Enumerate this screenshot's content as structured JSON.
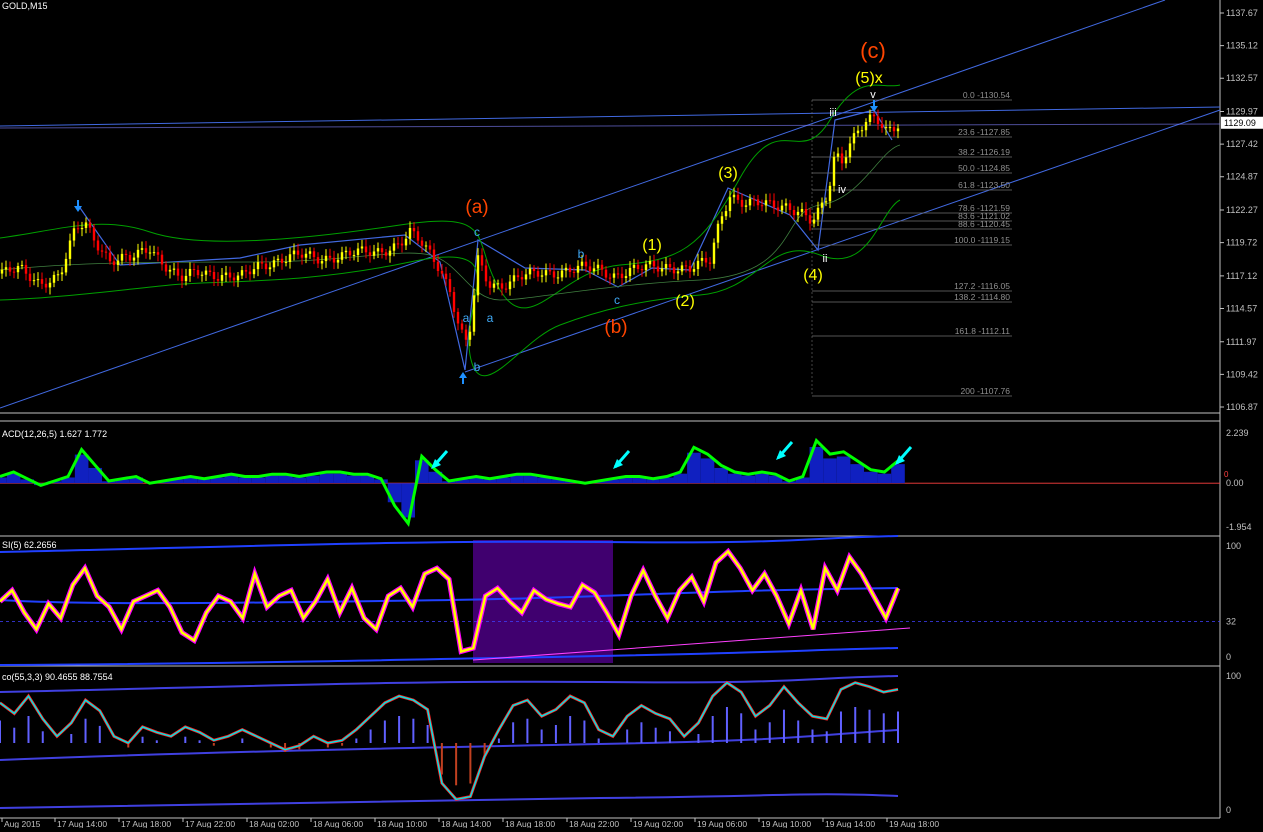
{
  "window_title": "GOLD,M15",
  "price_axis": {
    "ticks": [
      "1137.67",
      "1135.12",
      "1132.57",
      "1129.97",
      "1127.42",
      "1124.87",
      "1122.27",
      "1119.72",
      "1117.12",
      "1114.57",
      "1111.97",
      "1109.42",
      "1106.87"
    ],
    "current_price": "1129.09"
  },
  "fib_levels": [
    "0.0 -1130.54",
    "23.6 -1127.85",
    "38.2 -1126.19",
    "50.0 -1124.85",
    "61.8 -1123.50",
    "78.6 -1121.59",
    "83.6 -1121.02",
    "88.6 -1120.45",
    "100.0 -1119.15",
    "127.2 -1116.05",
    "138.2 -1114.80",
    "161.8 -1112.11",
    "200 -1107.76"
  ],
  "wave_labels": {
    "red": [
      "(c)",
      "(a)",
      "(b)"
    ],
    "yellow": [
      "(5)x",
      "(3)",
      "(1)",
      "(2)",
      "(4)"
    ],
    "blue": [
      "c",
      "b",
      "c",
      "a",
      "a",
      "b"
    ],
    "white": [
      "v",
      "iii",
      "iv",
      "ii"
    ]
  },
  "macd": {
    "label": "ACD(12,26,5) 1.627 1.772",
    "ticks": [
      "2.239",
      "0.00",
      "-1.954"
    ],
    "marker": "0"
  },
  "rsi": {
    "label": "SI(5) 62.2656",
    "ticks": [
      "100",
      "32",
      "0"
    ]
  },
  "stoch": {
    "label": "co(55,3,3) 90.4655 88.7554",
    "ticks": [
      "100",
      "0"
    ]
  },
  "time_axis": [
    "Aug 2015",
    "17 Aug 14:00",
    "17 Aug 18:00",
    "17 Aug 22:00",
    "18 Aug 02:00",
    "18 Aug 06:00",
    "18 Aug 10:00",
    "18 Aug 14:00",
    "18 Aug 18:00",
    "18 Aug 22:00",
    "19 Aug 02:00",
    "19 Aug 06:00",
    "19 Aug 10:00",
    "19 Aug 14:00",
    "19 Aug 18:00"
  ],
  "colors": {
    "bull": "#ffff00",
    "bear": "#ff0000",
    "channel": "#4169e1",
    "band": "#00a000",
    "macd_line": "#00ff00",
    "rsi_line": "#ffff00",
    "rsi_glow": "#ff00ff",
    "stoch_main": "#00e5e5",
    "highlight": "#4b0082"
  },
  "chart_data": [
    {
      "type": "candlestick",
      "title": "GOLD,M15",
      "ylim": [
        1106.87,
        1137.67
      ],
      "close_path": [
        [
          0,
          1117.3
        ],
        [
          20,
          1117.6
        ],
        [
          40,
          1116.6
        ],
        [
          60,
          1117.1
        ],
        [
          75,
          1120.6
        ],
        [
          85,
          1121.3
        ],
        [
          95,
          1120.0
        ],
        [
          110,
          1118.3
        ],
        [
          130,
          1118.4
        ],
        [
          150,
          1119.4
        ],
        [
          165,
          1118.0
        ],
        [
          180,
          1116.8
        ],
        [
          200,
          1117.5
        ],
        [
          220,
          1117.2
        ],
        [
          240,
          1116.9
        ],
        [
          260,
          1118.0
        ],
        [
          280,
          1118.4
        ],
        [
          300,
          1118.7
        ],
        [
          320,
          1118.5
        ],
        [
          340,
          1118.7
        ],
        [
          360,
          1118.9
        ],
        [
          380,
          1119.1
        ],
        [
          400,
          1119.6
        ],
        [
          410,
          1120.4
        ],
        [
          420,
          1119.8
        ],
        [
          430,
          1118.9
        ],
        [
          440,
          1117.8
        ],
        [
          450,
          1116.0
        ],
        [
          460,
          1112.8
        ],
        [
          468,
          1111.5
        ],
        [
          478,
          1118.3
        ],
        [
          488,
          1116.6
        ],
        [
          500,
          1116.4
        ],
        [
          520,
          1117.0
        ],
        [
          540,
          1117.3
        ],
        [
          560,
          1117.5
        ],
        [
          580,
          1117.7
        ],
        [
          600,
          1117.6
        ],
        [
          615,
          1117.2
        ],
        [
          630,
          1117.5
        ],
        [
          650,
          1117.8
        ],
        [
          670,
          1117.9
        ],
        [
          690,
          1117.6
        ],
        [
          710,
          1118.3
        ],
        [
          720,
          1121.6
        ],
        [
          730,
          1123.5
        ],
        [
          745,
          1122.7
        ],
        [
          765,
          1122.7
        ],
        [
          785,
          1122.7
        ],
        [
          800,
          1122.1
        ],
        [
          812,
          1121.2
        ],
        [
          820,
          1122.2
        ],
        [
          828,
          1123.5
        ],
        [
          835,
          1126.8
        ],
        [
          842,
          1126.3
        ],
        [
          850,
          1127.5
        ],
        [
          858,
          1128.5
        ],
        [
          868,
          1129.1
        ],
        [
          876,
          1129.4
        ],
        [
          885,
          1128.4
        ],
        [
          898,
          1129.09
        ]
      ]
    },
    {
      "type": "line",
      "title": "ACD(12,26,5)",
      "ylim": [
        -1.954,
        2.239
      ],
      "values": [
        0.3,
        0.5,
        0.2,
        -0.1,
        0.1,
        0.3,
        1.5,
        0.8,
        0.1,
        0.2,
        0.3,
        0.0,
        0.1,
        0.2,
        0.3,
        0.2,
        0.3,
        0.4,
        0.3,
        0.3,
        0.4,
        0.4,
        0.3,
        0.4,
        0.5,
        0.5,
        0.4,
        0.4,
        0.2,
        -1.0,
        -1.8,
        1.2,
        0.6,
        0.1,
        0.2,
        0.3,
        0.2,
        0.3,
        0.4,
        0.4,
        0.3,
        0.2,
        0.1,
        0.0,
        0.1,
        0.2,
        0.3,
        0.3,
        0.2,
        0.3,
        0.5,
        1.6,
        1.3,
        0.8,
        0.5,
        0.4,
        0.5,
        0.4,
        0.1,
        0.3,
        1.9,
        1.3,
        1.4,
        1.0,
        0.6,
        0.5,
        1.0
      ]
    },
    {
      "type": "line",
      "title": "SI(5)",
      "ylim": [
        0,
        100
      ],
      "values": [
        50,
        60,
        40,
        25,
        48,
        35,
        65,
        80,
        55,
        45,
        25,
        50,
        55,
        60,
        45,
        22,
        15,
        40,
        55,
        50,
        35,
        75,
        45,
        55,
        60,
        35,
        50,
        70,
        40,
        62,
        35,
        25,
        55,
        62,
        45,
        75,
        80,
        70,
        5,
        8,
        55,
        62,
        50,
        40,
        60,
        52,
        48,
        45,
        65,
        58,
        40,
        20,
        55,
        78,
        55,
        35,
        60,
        72,
        50,
        85,
        95,
        80,
        60,
        75,
        55,
        30,
        60,
        25,
        80,
        60,
        90,
        75,
        55,
        35,
        62
      ]
    },
    {
      "type": "line",
      "title": "co(55,3,3)",
      "ylim": [
        0,
        100
      ],
      "values": [
        80,
        72,
        85,
        68,
        55,
        65,
        82,
        74,
        55,
        50,
        62,
        58,
        55,
        62,
        58,
        52,
        55,
        60,
        55,
        50,
        45,
        48,
        55,
        50,
        52,
        60,
        70,
        80,
        85,
        82,
        75,
        20,
        8,
        10,
        40,
        60,
        78,
        82,
        70,
        75,
        85,
        80,
        60,
        55,
        70,
        78,
        72,
        68,
        55,
        65,
        85,
        95,
        88,
        70,
        78,
        92,
        80,
        70,
        68,
        90,
        95,
        92,
        88,
        90
      ]
    }
  ]
}
